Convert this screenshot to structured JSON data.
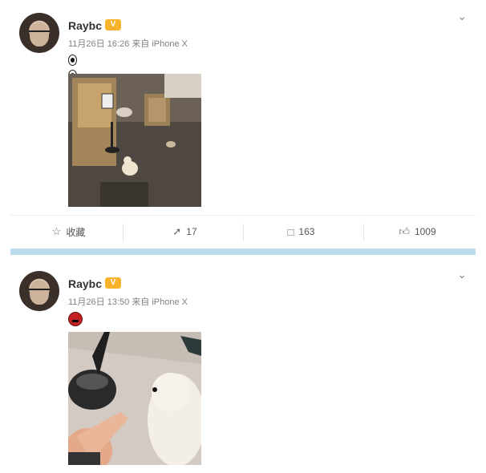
{
  "posts": [
    {
      "username": "Raybc",
      "badge_text": "V",
      "time": "11月26日 16:26",
      "via": "来自 iPhone X",
      "emoji": "eyes-emoji",
      "actions": {
        "favorite_label": "收藏",
        "repost_count": "17",
        "comment_count": "163",
        "like_count": "1009"
      }
    },
    {
      "username": "Raybc",
      "badge_text": "V",
      "time": "11月26日 13:50",
      "via": "来自 iPhone X",
      "emoji": "angry-face-emoji"
    }
  ],
  "colors": {
    "divider": "#b8dcea",
    "badge": "#f7b22c"
  }
}
